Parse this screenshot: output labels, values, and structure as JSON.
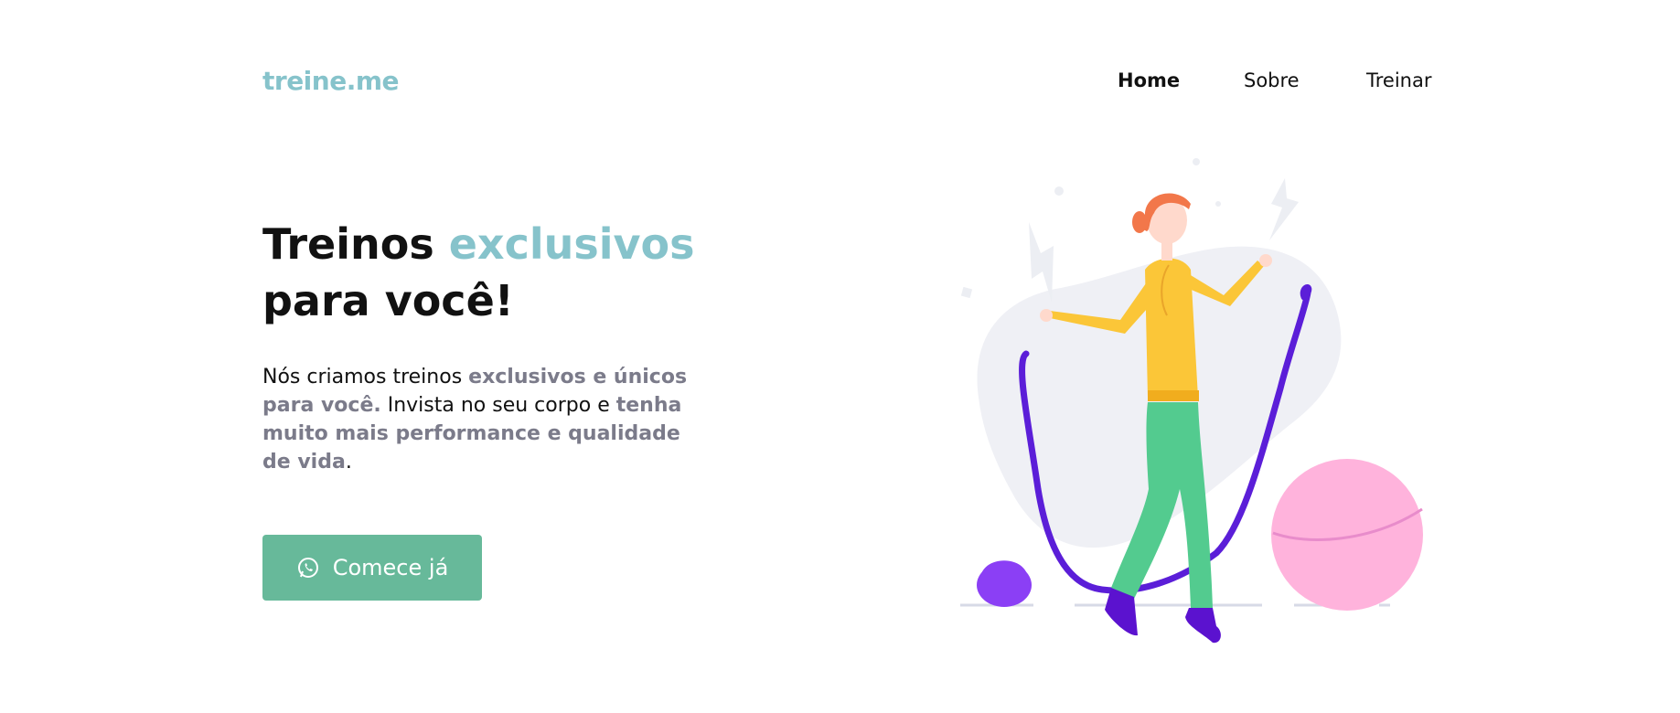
{
  "header": {
    "logo": "treine.me",
    "nav": [
      {
        "label": "Home",
        "active": true
      },
      {
        "label": "Sobre",
        "active": false
      },
      {
        "label": "Treinar",
        "active": false
      }
    ]
  },
  "hero": {
    "title_part1": "Treinos ",
    "title_accent": "exclusivos",
    "title_part2": "para você!",
    "text_1": "Nós criamos treinos ",
    "text_2": "exclusivos e únicos para você.",
    "text_3": " Invista no seu corpo e ",
    "text_4": "tenha muito mais performance e qualidade de vida",
    "text_5": ".",
    "cta_label": "Comece já",
    "cta_icon": "whatsapp-icon"
  },
  "colors": {
    "accent": "#86c3cb",
    "button": "#67b99a",
    "muted": "#7b7b8a"
  }
}
